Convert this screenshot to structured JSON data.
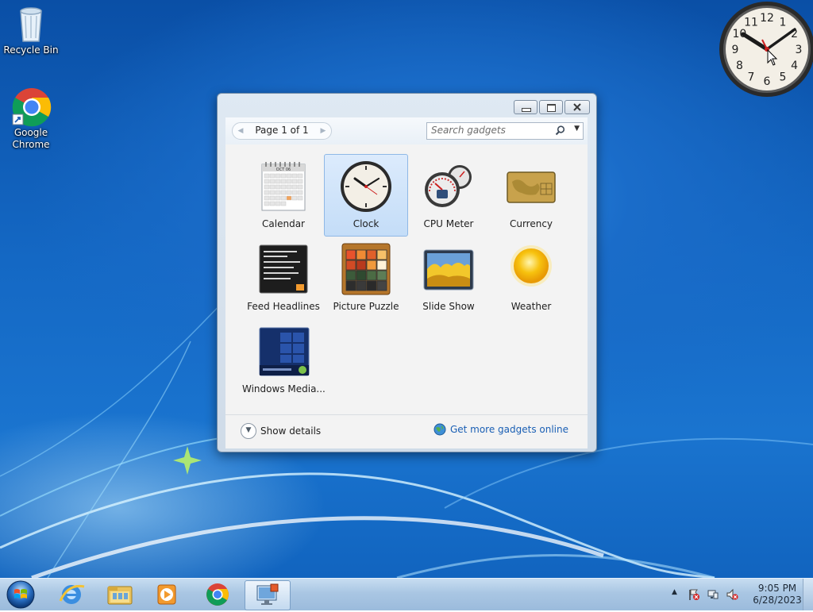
{
  "desktop": {
    "icons": [
      {
        "label": "Recycle Bin",
        "icon": "recycle-bin-icon"
      },
      {
        "label": "Google Chrome",
        "icon": "chrome-icon"
      }
    ]
  },
  "clock_gadget": {
    "time": "10:10",
    "numerals": [
      "12",
      "1",
      "2",
      "3",
      "4",
      "5",
      "6",
      "7",
      "8",
      "9",
      "10",
      "11"
    ]
  },
  "gallery": {
    "pager_label": "Page 1 of 1",
    "search_placeholder": "Search gadgets",
    "gadgets": [
      {
        "name": "Calendar",
        "icon": "calendar-gadget-icon",
        "selected": false
      },
      {
        "name": "Clock",
        "icon": "clock-gadget-icon",
        "selected": true
      },
      {
        "name": "CPU Meter",
        "icon": "cpu-meter-gadget-icon",
        "selected": false
      },
      {
        "name": "Currency",
        "icon": "currency-gadget-icon",
        "selected": false
      },
      {
        "name": "Feed Headlines",
        "icon": "feed-headlines-gadget-icon",
        "selected": false
      },
      {
        "name": "Picture Puzzle",
        "icon": "picture-puzzle-gadget-icon",
        "selected": false
      },
      {
        "name": "Slide Show",
        "icon": "slide-show-gadget-icon",
        "selected": false
      },
      {
        "name": "Weather",
        "icon": "weather-gadget-icon",
        "selected": false
      },
      {
        "name": "Windows Media...",
        "icon": "windows-media-gadget-icon",
        "selected": false
      }
    ],
    "calendar_thumb_month": "OCT 06",
    "show_details_label": "Show details",
    "more_gadgets_label": "Get more gadgets online"
  },
  "taskbar": {
    "items": [
      {
        "name": "start-button",
        "icon": "windows-orb-icon"
      },
      {
        "name": "internet-explorer",
        "icon": "internet-explorer-icon"
      },
      {
        "name": "windows-explorer",
        "icon": "folder-icon"
      },
      {
        "name": "media-player",
        "icon": "media-player-icon"
      },
      {
        "name": "google-chrome",
        "icon": "chrome-icon"
      },
      {
        "name": "gadget-gallery",
        "icon": "gadget-gallery-icon",
        "active": true
      }
    ],
    "clock_time": "9:05 PM",
    "clock_date": "6/28/2023"
  },
  "colors": {
    "desktop_blue": "#1468c4",
    "link": "#1a5fb4",
    "selection": "#c4ddf8",
    "clock_second_hand": "#cc1f1f"
  }
}
